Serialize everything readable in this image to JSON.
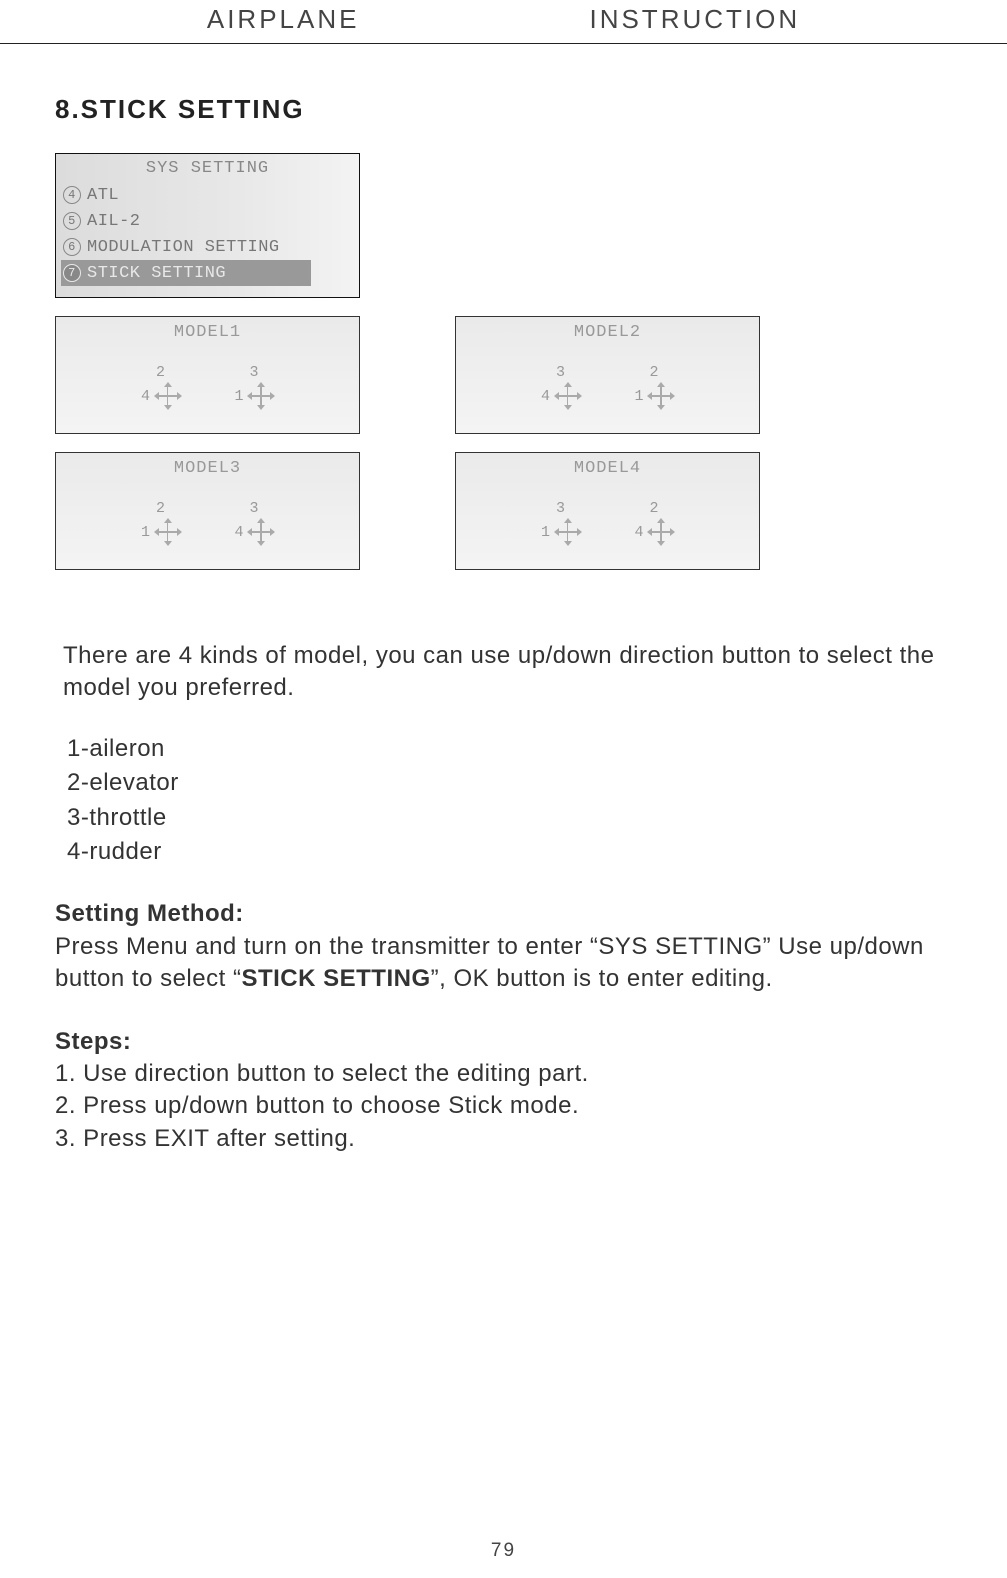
{
  "header": {
    "left": "AIRPLANE",
    "right": "INSTRUCTION"
  },
  "section_title": "8.STICK SETTING",
  "sys_panel": {
    "title": "SYS SETTING",
    "rows": [
      {
        "num": "4",
        "label": "ATL"
      },
      {
        "num": "5",
        "label": "AIL-2"
      },
      {
        "num": "6",
        "label": "MODULATION SETTING"
      },
      {
        "num": "7",
        "label": "STICK SETTING",
        "selected": true
      }
    ]
  },
  "models": [
    {
      "title": "MODEL1",
      "left_top": "2",
      "left_side": "4",
      "right_top": "3",
      "right_side": "1"
    },
    {
      "title": "MODEL2",
      "left_top": "3",
      "left_side": "4",
      "right_top": "2",
      "right_side": "1"
    },
    {
      "title": "MODEL3",
      "left_top": "2",
      "left_side": "1",
      "right_top": "3",
      "right_side": "4"
    },
    {
      "title": "MODEL4",
      "left_top": "3",
      "left_side": "1",
      "right_top": "2",
      "right_side": "4"
    }
  ],
  "intro": "There are 4 kinds of model, you can use up/down direction button to select the model you preferred.",
  "legend": [
    "1-aileron",
    "2-elevator",
    "3-throttle",
    "4-rudder"
  ],
  "method": {
    "label": "Setting Method:",
    "text_a": "Press Menu and turn on the transmitter to enter “SYS SETTING” Use up/down button to select “",
    "text_bold": "STICK SETTING",
    "text_b": "”, OK button is to enter editing."
  },
  "steps": {
    "label": "Steps:",
    "items": [
      "1. Use direction button to select the editing part.",
      "2. Press up/down button to choose Stick mode.",
      "3. Press EXIT after setting."
    ]
  },
  "page": "79"
}
